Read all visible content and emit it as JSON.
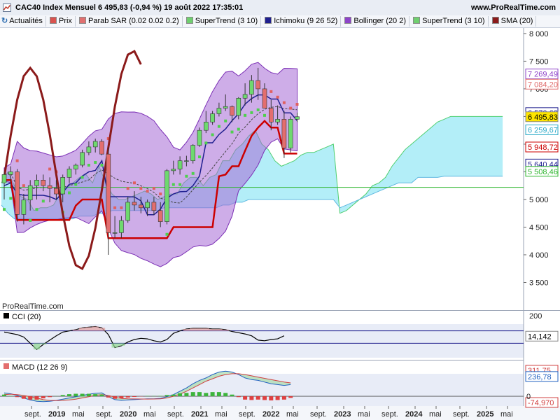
{
  "header": {
    "title": "CAC40 Index Mensuel 6 495,83 (-0,94 %) 19 août 2022 17:35:01",
    "site": "www.ProRealTime.com"
  },
  "toolbar": {
    "refresh_label": "Actualités",
    "items": [
      {
        "label": "Prix",
        "color": "#d9534f"
      },
      {
        "label": "Parab SAR (0.02 0.02 0.2)",
        "color": "#e07070"
      },
      {
        "label": "SuperTrend (3 10)",
        "color": "#6fcf6f"
      },
      {
        "label": "Ichimoku (9 26 52)",
        "color": "#1f1f8f"
      },
      {
        "label": "Bollinger (20 2)",
        "color": "#8e44c9"
      },
      {
        "label": "SuperTrend (3 10)",
        "color": "#6fcf6f"
      },
      {
        "label": "SMA (20)",
        "color": "#8b1a1a"
      }
    ]
  },
  "watermark": "ProRealTime.com",
  "chart_data": {
    "type": "line",
    "title": "CAC40 Index Mensuel 6 495,83 (-0,94 %) 19 août 2022 17:35:01",
    "x_ticks": [
      "sept.",
      "2019",
      "mai",
      "sept.",
      "2020",
      "mai",
      "sept.",
      "2021",
      "mai",
      "sept.",
      "2022",
      "mai",
      "sept.",
      "2023",
      "mai",
      "sept.",
      "2024",
      "mai",
      "sept.",
      "2025",
      "mai"
    ],
    "main_panel": {
      "ylim": [
        3000,
        8100
      ],
      "y_ticks": [
        8000,
        7500,
        7000,
        6500,
        6000,
        5500,
        5000,
        4500,
        4000,
        3500
      ],
      "y_tick_labels": [
        "8 000",
        "7 500",
        "7 000",
        "6 500",
        "6 000",
        "5 500",
        "5 000",
        "4 500",
        "4 000",
        "3 500"
      ],
      "price_labels": [
        {
          "value": 7269.49,
          "text": "7 269,49",
          "color": "#8e44c9"
        },
        {
          "value": 7084.2,
          "text": "7 084,20",
          "color": "#e07070"
        },
        {
          "value": 6570.62,
          "text": "6 570,62",
          "color": "#1f1f8f"
        },
        {
          "value": 6495.83,
          "text": "6 495,83",
          "color": "#000000",
          "current": true
        },
        {
          "value": 6259.67,
          "text": "6 259,67",
          "color": "#2aa9c7"
        },
        {
          "value": 5948.72,
          "text": "5 948,72",
          "color": "#cc0000"
        },
        {
          "value": 5640.44,
          "text": "5 640,44",
          "color": "#1f1f8f"
        },
        {
          "value": 5508.46,
          "text": "5 508,46",
          "color": "#2db52d"
        }
      ],
      "candles": [
        {
          "o": 5300,
          "h": 5500,
          "l": 5000,
          "c": 5450
        },
        {
          "o": 5450,
          "h": 5600,
          "l": 5200,
          "c": 5500
        },
        {
          "o": 5500,
          "h": 5550,
          "l": 4600,
          "c": 4730
        },
        {
          "o": 4730,
          "h": 5100,
          "l": 4550,
          "c": 4990
        },
        {
          "o": 4990,
          "h": 5350,
          "l": 4800,
          "c": 5250
        },
        {
          "o": 5250,
          "h": 5450,
          "l": 5000,
          "c": 5350
        },
        {
          "o": 5350,
          "h": 5450,
          "l": 5150,
          "c": 5250
        },
        {
          "o": 5250,
          "h": 5400,
          "l": 4950,
          "c": 5200
        },
        {
          "o": 5200,
          "h": 5350,
          "l": 5000,
          "c": 5100
        },
        {
          "o": 5100,
          "h": 5450,
          "l": 4950,
          "c": 5400
        },
        {
          "o": 5400,
          "h": 5600,
          "l": 5300,
          "c": 5550
        },
        {
          "o": 5550,
          "h": 5650,
          "l": 5450,
          "c": 5620
        },
        {
          "o": 5620,
          "h": 5900,
          "l": 5580,
          "c": 5850
        },
        {
          "o": 5850,
          "h": 6050,
          "l": 5800,
          "c": 5950
        },
        {
          "o": 5950,
          "h": 6100,
          "l": 5850,
          "c": 6050
        },
        {
          "o": 6050,
          "h": 6090,
          "l": 5800,
          "c": 5820
        },
        {
          "o": 5820,
          "h": 5950,
          "l": 4000,
          "c": 4400
        },
        {
          "o": 4400,
          "h": 4700,
          "l": 4300,
          "c": 4400
        },
        {
          "o": 4400,
          "h": 4700,
          "l": 4300,
          "c": 4620
        },
        {
          "o": 4620,
          "h": 5050,
          "l": 4580,
          "c": 4950
        },
        {
          "o": 4950,
          "h": 5150,
          "l": 4800,
          "c": 4900
        },
        {
          "o": 4900,
          "h": 5050,
          "l": 4750,
          "c": 4850
        },
        {
          "o": 4850,
          "h": 5000,
          "l": 4700,
          "c": 4950
        },
        {
          "o": 4950,
          "h": 5050,
          "l": 4720,
          "c": 4800
        },
        {
          "o": 4800,
          "h": 4950,
          "l": 4500,
          "c": 4600
        },
        {
          "o": 4600,
          "h": 5550,
          "l": 4550,
          "c": 5520
        },
        {
          "o": 5520,
          "h": 5700,
          "l": 5450,
          "c": 5550
        },
        {
          "o": 5550,
          "h": 5780,
          "l": 5450,
          "c": 5700
        },
        {
          "o": 5700,
          "h": 5790,
          "l": 5600,
          "c": 5700
        },
        {
          "o": 5700,
          "h": 6000,
          "l": 5650,
          "c": 5980
        },
        {
          "o": 5980,
          "h": 6300,
          "l": 5950,
          "c": 6250
        },
        {
          "o": 6250,
          "h": 6600,
          "l": 6200,
          "c": 6400
        },
        {
          "o": 6400,
          "h": 6600,
          "l": 6350,
          "c": 6550
        },
        {
          "o": 6550,
          "h": 6750,
          "l": 6500,
          "c": 6650
        },
        {
          "o": 6650,
          "h": 6900,
          "l": 6600,
          "c": 6680
        },
        {
          "o": 6680,
          "h": 6700,
          "l": 6400,
          "c": 6520
        },
        {
          "o": 6520,
          "h": 6850,
          "l": 6450,
          "c": 6830
        },
        {
          "o": 6830,
          "h": 7100,
          "l": 6700,
          "c": 6900
        },
        {
          "o": 6900,
          "h": 7250,
          "l": 6750,
          "c": 7150
        },
        {
          "o": 7150,
          "h": 7380,
          "l": 6800,
          "c": 7000
        },
        {
          "o": 7000,
          "h": 7100,
          "l": 6700,
          "c": 6650
        },
        {
          "o": 6650,
          "h": 6800,
          "l": 6250,
          "c": 6400
        },
        {
          "o": 6400,
          "h": 6700,
          "l": 6350,
          "c": 6450
        },
        {
          "o": 6450,
          "h": 6600,
          "l": 5750,
          "c": 5930
        },
        {
          "o": 5930,
          "h": 6500,
          "l": 5850,
          "c": 6450
        },
        {
          "o": 6450,
          "h": 6570,
          "l": 6400,
          "c": 6496
        }
      ],
      "ichimoku_cloud": {
        "span_a_main": [
          5300,
          5500,
          5250,
          5050,
          5000,
          4800,
          4850,
          4850,
          4900,
          5100,
          5200,
          5300,
          5400,
          5450,
          5300,
          5600,
          5300,
          5100,
          5000,
          5000,
          5050,
          5100,
          5150,
          5100,
          5000,
          5050,
          5100,
          5100,
          5300,
          5400,
          5400,
          5250,
          5400,
          5450,
          5700,
          5700,
          5900,
          6000,
          6150,
          6250,
          6000,
          5900,
          5700,
          5600,
          5650,
          5700,
          5800,
          5850,
          5850,
          5900,
          5950,
          6000
        ],
        "span_b_main": [
          4900,
          4750,
          4650,
          4650,
          4650,
          4650,
          4650,
          4650,
          4650,
          4650,
          4650,
          4650,
          4700,
          4700,
          4700,
          4750,
          4750,
          4800,
          4800,
          4800,
          4800,
          4800,
          4800,
          4800,
          4800,
          4850,
          4850,
          4850,
          4850,
          4850,
          4850,
          4850,
          4850,
          4850,
          4900,
          4900,
          4950,
          4950,
          5000,
          5000,
          5000,
          5000,
          5000,
          5000,
          5000,
          5000,
          5000,
          5000,
          5000,
          5000,
          5000,
          5000
        ],
        "span_a_future": [
          4750,
          4800,
          4900,
          5000,
          5100,
          5250,
          5300,
          5400,
          5600,
          5750,
          5900,
          6000,
          6100,
          6200,
          6300,
          6400,
          6450,
          6500,
          6500,
          6500,
          6500,
          6500,
          6500,
          6500,
          6500,
          6500
        ],
        "span_b_future": [
          4850,
          4900,
          4950,
          5000,
          5050,
          5100,
          5150,
          5200,
          5250,
          5300,
          5300,
          5300,
          5400,
          5400,
          5400,
          5400,
          5420,
          5420,
          5420,
          5420,
          5420,
          5420,
          5420,
          5420,
          5420,
          5420
        ]
      }
    },
    "cci_panel": {
      "label": "CCI (20)",
      "ylim": [
        -300,
        300
      ],
      "y_tick_labels": [
        "200"
      ],
      "last_value_text": "14,142",
      "levels": [
        100,
        -100
      ],
      "values": [
        80,
        60,
        40,
        0,
        -100,
        -200,
        -120,
        -50,
        20,
        80,
        100,
        120,
        150,
        160,
        170,
        150,
        40,
        -170,
        -140,
        -80,
        -40,
        -20,
        -30,
        -60,
        -80,
        -40,
        60,
        100,
        130,
        140,
        140,
        140,
        130,
        130,
        120,
        90,
        70,
        50,
        20,
        -50,
        -60,
        -40,
        -30,
        20
      ]
    },
    "macd_panel": {
      "label": "MACD (12 26 9)",
      "ylim": [
        -100,
        370
      ],
      "y_tick_labels": [
        "311,75",
        "236,78",
        "-74,970"
      ],
      "zero_tick_label": "0",
      "macd": [
        40,
        30,
        10,
        -20,
        -45,
        -60,
        -65,
        -60,
        -50,
        -35,
        -20,
        -5,
        10,
        25,
        35,
        40,
        -5,
        -40,
        -50,
        -45,
        -40,
        -35,
        -30,
        -30,
        -25,
        -5,
        20,
        60,
        100,
        150,
        190,
        220,
        260,
        290,
        300,
        290,
        260,
        220,
        200,
        190,
        170,
        150,
        140,
        130,
        140
      ],
      "signal": [
        20,
        25,
        20,
        10,
        -5,
        -20,
        -40,
        -50,
        -52,
        -50,
        -45,
        -35,
        -20,
        -5,
        10,
        20,
        10,
        -10,
        -25,
        -30,
        -32,
        -33,
        -34,
        -33,
        -30,
        -20,
        0,
        25,
        60,
        100,
        140,
        180,
        210,
        240,
        260,
        270,
        270,
        260,
        245,
        230,
        215,
        200,
        185,
        170,
        160
      ],
      "histogram": [
        20,
        5,
        -10,
        -30,
        -40,
        -40,
        -25,
        -10,
        2,
        15,
        25,
        30,
        30,
        30,
        25,
        20,
        -15,
        -30,
        -25,
        -15,
        -8,
        -2,
        4,
        3,
        5,
        15,
        20,
        35,
        40,
        50,
        50,
        40,
        50,
        50,
        40,
        20,
        -10,
        -40,
        -45,
        -40,
        -45,
        -50,
        -45,
        -40,
        -20
      ]
    }
  }
}
